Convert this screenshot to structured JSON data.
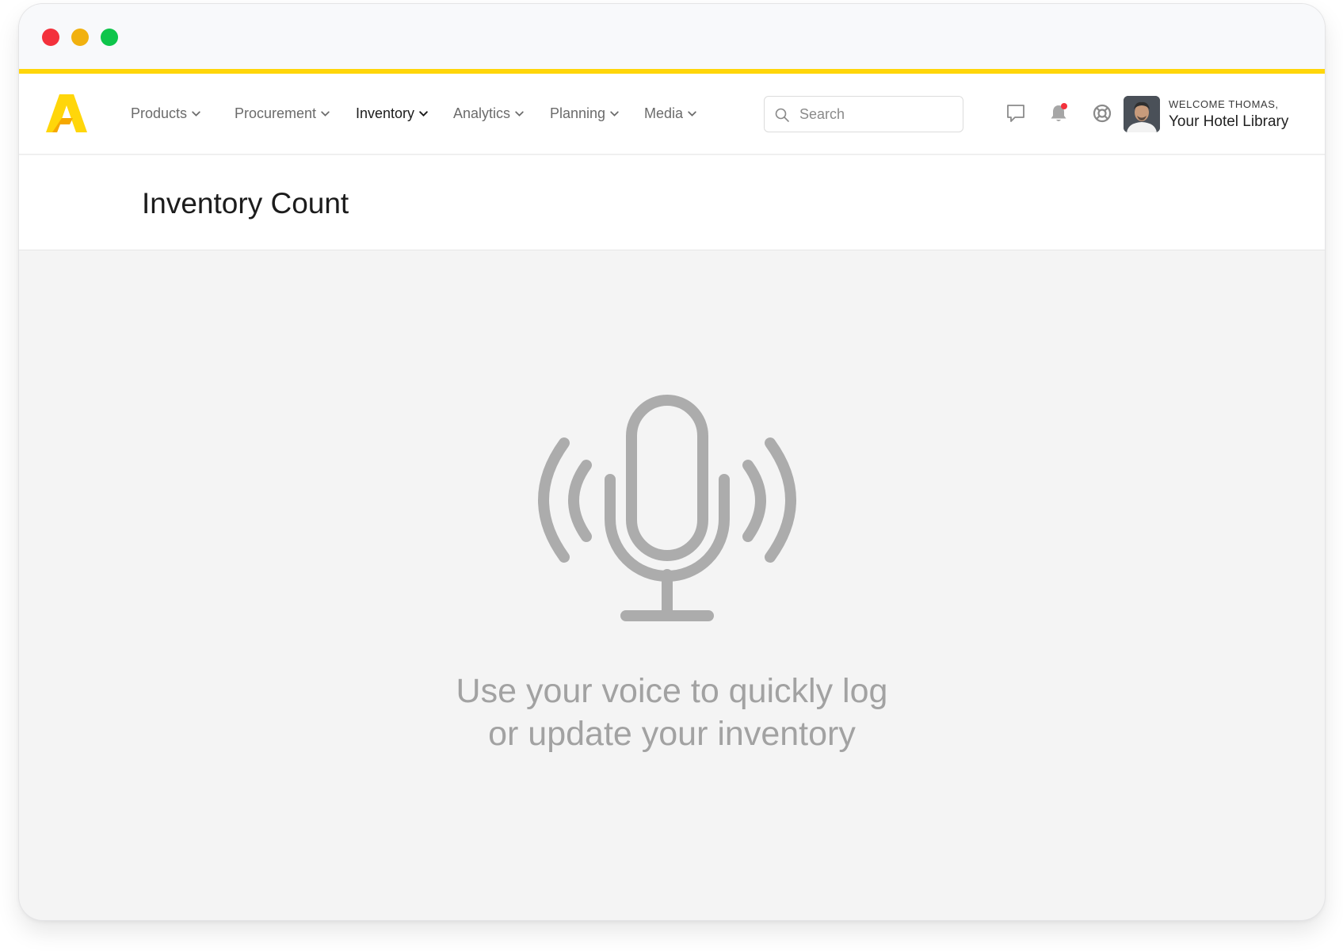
{
  "window": {
    "controls": [
      "close",
      "minimize",
      "maximize"
    ],
    "accent_color": "#ffd60a"
  },
  "nav": {
    "logo": "brand-logo-a",
    "items": [
      {
        "label": "Products",
        "active": false
      },
      {
        "label": "Procurement",
        "active": false
      },
      {
        "label": "Inventory",
        "active": true
      },
      {
        "label": "Analytics",
        "active": false
      },
      {
        "label": "Planning",
        "active": false
      },
      {
        "label": "Media",
        "active": false
      }
    ],
    "search": {
      "placeholder": "Search",
      "value": ""
    },
    "icons": [
      "chat-icon",
      "bell-icon",
      "help-lifebuoy-icon"
    ],
    "notification_color": "#f3313c",
    "user": {
      "welcome": "WELCOME THOMAS,",
      "account": "Your Hotel Library"
    }
  },
  "page": {
    "title": "Inventory Count",
    "empty_state": {
      "icon": "microphone-icon",
      "line1": "Use your voice to quickly log",
      "line2": "or update your inventory"
    }
  }
}
